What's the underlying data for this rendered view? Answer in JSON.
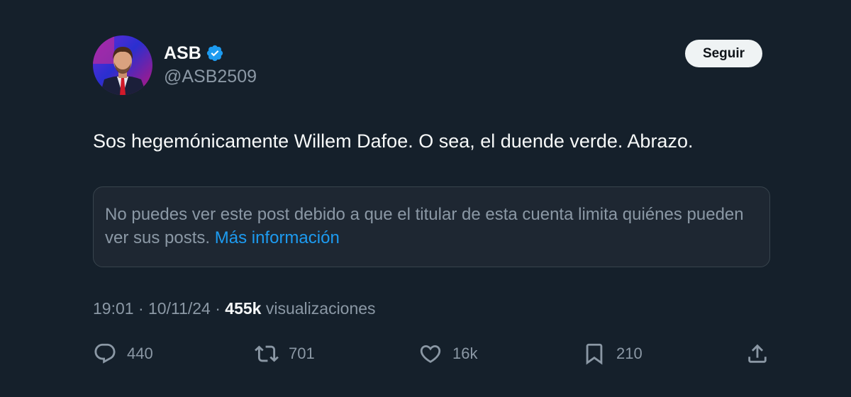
{
  "author": {
    "name": "ASB",
    "handle": "@ASB2509",
    "verified": true,
    "avatar_icon": "profile-photo"
  },
  "follow_button": {
    "label": "Seguir"
  },
  "tweet": {
    "text": "Sos hegemónicamente Willem Dafoe. O sea, el duende verde. Abrazo."
  },
  "restricted_notice": {
    "text": "No puedes ver este post debido a que el titular de esta cuenta limita quiénes pueden ver sus posts.",
    "link_label": "Más información"
  },
  "meta": {
    "time": "19:01",
    "separator": "·",
    "date": "10/11/24",
    "views_count": "455k",
    "views_label": "visualizaciones"
  },
  "actions": {
    "replies": "440",
    "reposts": "701",
    "likes": "16k",
    "bookmarks": "210"
  },
  "colors": {
    "background": "#15202b",
    "accent": "#1d9bf0",
    "text_primary": "#f7f9f9",
    "text_secondary": "#8b98a5",
    "follow_button_bg": "#eff3f4"
  }
}
